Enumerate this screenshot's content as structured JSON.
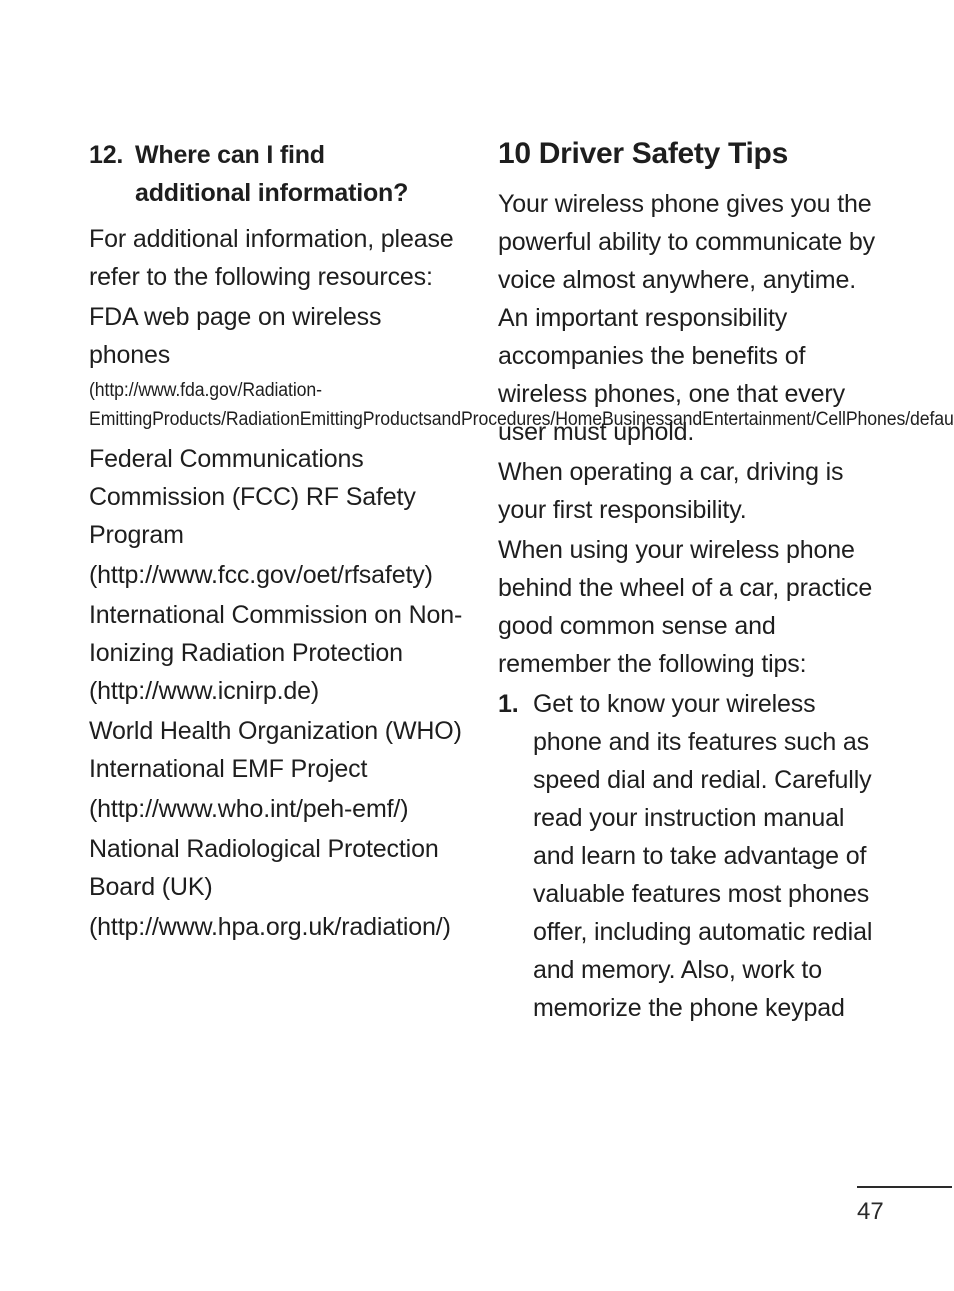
{
  "page": {
    "number": "47",
    "footer_rule": true
  },
  "left_column": {
    "heading": {
      "marker": "12.",
      "line1": "Where can I find",
      "line2": "additional information?"
    },
    "blocks": [
      {
        "name": "intro-paragraph",
        "style": "body",
        "text": "For additional information, please refer to the following resources:"
      },
      {
        "name": "fda-resource-title",
        "style": "body",
        "text": "FDA web page on wireless phones"
      },
      {
        "name": "fda-resource-url",
        "style": "url-small",
        "text": "(http://www.fda.gov/Radiation-EmittingProducts/RadiationEmittingProductsandProcedures/HomeBusinessandEntertainment/CellPhones/default.htm)"
      },
      {
        "name": "fcc-resource-title",
        "style": "body",
        "text": "Federal Communications Commission (FCC) RF Safety Program"
      },
      {
        "name": "fcc-resource-url",
        "style": "body",
        "text": "(http://www.fcc.gov/oet/rfsafety)"
      },
      {
        "name": "icnirp-resource",
        "style": "body",
        "text": "International Commission on Non-Ionizing Radiation Protection (http://www.icnirp.de)"
      },
      {
        "name": "who-resource-title",
        "style": "body",
        "text": "World Health Organization (WHO) International EMF Project"
      },
      {
        "name": "who-resource-url",
        "style": "body",
        "text": "(http://www.who.int/peh-emf/)"
      },
      {
        "name": "nrpb-resource-title",
        "style": "body",
        "text": "National Radiological Protection Board (UK)"
      },
      {
        "name": "nrpb-resource-url",
        "style": "body",
        "text": "(http://www.hpa.org.uk/radiation/)"
      }
    ]
  },
  "right_column": {
    "heading": "10 Driver Safety Tips",
    "paragraphs": [
      "Your wireless phone gives you the powerful ability to communicate by voice almost anywhere, anytime. An important responsibility accompanies the benefits of wireless phones, one that every user must uphold.",
      "When operating a car, driving is your first responsibility.",
      "When using your wireless phone behind the wheel of a car, practice good common sense and remember the following tips:"
    ],
    "list_items": [
      {
        "marker": "1.",
        "text": "Get to know your wireless phone and its features such as speed dial and redial. Carefully read your instruction manual and learn to take advantage of valuable features most phones offer, including automatic redial and memory. Also, work to memorize the phone keypad"
      }
    ]
  }
}
